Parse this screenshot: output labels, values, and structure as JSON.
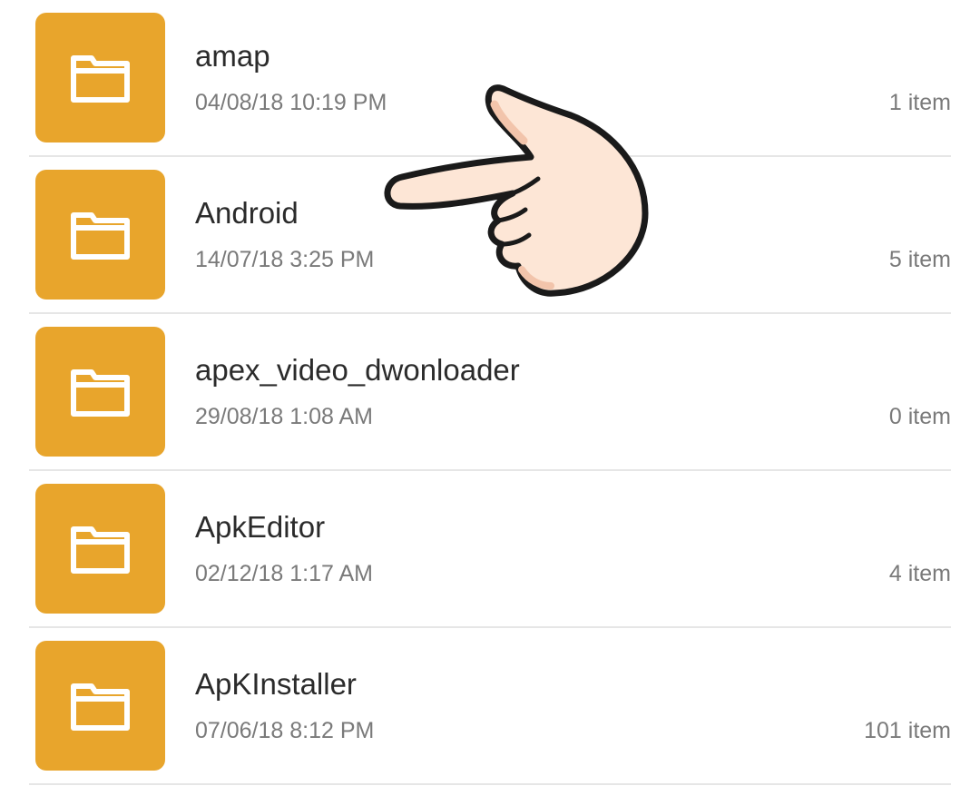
{
  "files": [
    {
      "name": "amap",
      "date": "04/08/18 10:19 PM",
      "count": "1 item"
    },
    {
      "name": "Android",
      "date": "14/07/18 3:25 PM",
      "count": "5 item"
    },
    {
      "name": "apex_video_dwonloader",
      "date": "29/08/18 1:08 AM",
      "count": "0 item"
    },
    {
      "name": "ApkEditor",
      "date": "02/12/18 1:17 AM",
      "count": "4 item"
    },
    {
      "name": "ApKInstaller",
      "date": "07/06/18 8:12 PM",
      "count": "101 item"
    }
  ],
  "icons": {
    "folder": "folder-icon",
    "pointer": "pointing-hand-icon"
  },
  "colors": {
    "folder_tile": "#e8a52c",
    "name_text": "#2b2b2b",
    "meta_text": "#7a7a7a",
    "divider": "#e6e6e6",
    "hand_fill": "#fde6d6",
    "hand_outline": "#1a1a1a"
  }
}
